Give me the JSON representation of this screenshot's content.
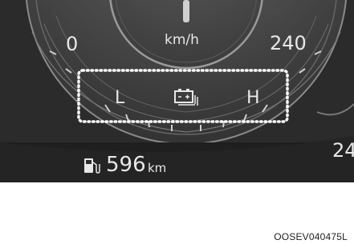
{
  "cluster": {
    "speed_unit": "km/h",
    "scale_min": "0",
    "scale_max": "240",
    "gauge_low_label": "L",
    "gauge_high_label": "H",
    "gauge_icon": "battery-icon",
    "range_value": "596",
    "range_unit": "km",
    "range_icon": "fuel-pump-icon",
    "right_partial_value": "24"
  },
  "caption": "OOSEV040475L",
  "colors": {
    "panel": "#2b2b2b",
    "text": "#e8e8e8",
    "highlight_box": "#ffffff"
  }
}
